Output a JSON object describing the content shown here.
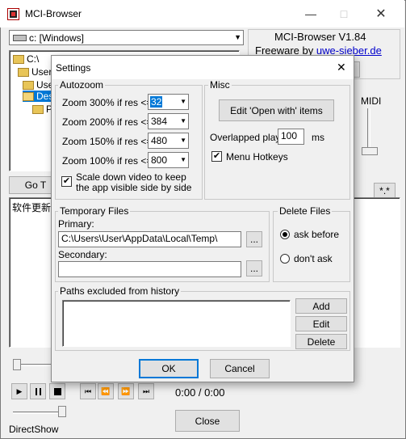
{
  "main_window": {
    "title": "MCI-Browser",
    "drive_select": "c: [Windows]",
    "header_line1": "MCI-Browser V1.84",
    "header_line2": "Freeware by ",
    "header_link": "uwe-sieber.de",
    "tree_items": [
      "C:\\",
      "Users",
      "User",
      "Des",
      "Pho"
    ],
    "goto_label": "Go T",
    "wildcard_label": "*.*",
    "midi_label": "MIDI",
    "file_list_item": "软件更新",
    "transport": {
      "play": "▶",
      "pause": "⏸",
      "stop": "■",
      "prev": "⏮",
      "rew": "⏪",
      "fwd": "⏩",
      "next": "⏭"
    },
    "time_display": "0:00 / 0:00",
    "close_label": "Close",
    "directshow_label": "DirectShow"
  },
  "dialog": {
    "title": "Settings",
    "close_glyph": "✕",
    "autozoom": {
      "label": "Autozoom",
      "rows": [
        {
          "label": "Zoom 300% if res <=",
          "value": "32"
        },
        {
          "label": "Zoom 200% if res <=",
          "value": "384"
        },
        {
          "label": "Zoom 150% if res <=",
          "value": "480"
        },
        {
          "label": "Zoom 100% if res <=",
          "value": "800"
        }
      ],
      "scale_down_line1": "Scale down video to keep",
      "scale_down_line2": "the app visible side by side",
      "scale_down_checked": "✔"
    },
    "misc": {
      "label": "Misc",
      "edit_open_with": "Edit 'Open with' items",
      "overlapped_label": "Overlapped play:",
      "overlapped_value": "100",
      "overlapped_unit": "ms",
      "menu_hotkeys_label": "Menu Hotkeys",
      "menu_hotkeys_checked": "✔"
    },
    "temp_files": {
      "label": "Temporary Files",
      "primary_label": "Primary:",
      "primary_value": "C:\\Users\\User\\AppData\\Local\\Temp\\",
      "secondary_label": "Secondary:",
      "secondary_value": "",
      "browse": "..."
    },
    "delete_files": {
      "label": "Delete Files",
      "ask_before": "ask before",
      "dont_ask": "don't ask"
    },
    "excluded": {
      "label": "Paths excluded from history",
      "add": "Add",
      "edit": "Edit",
      "delete": "Delete"
    },
    "ok": "OK",
    "cancel": "Cancel"
  }
}
